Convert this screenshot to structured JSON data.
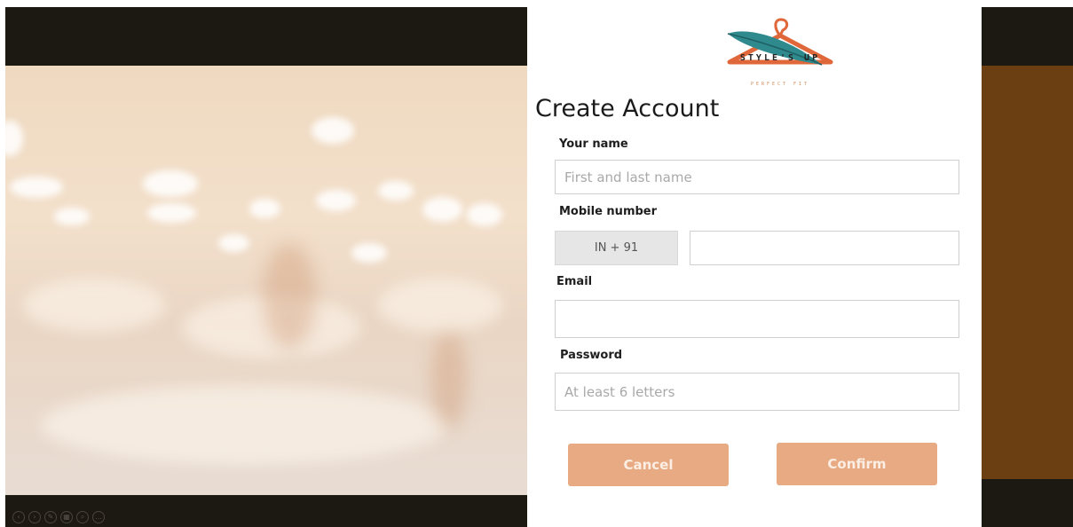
{
  "brand": {
    "name": "STYLE'S UP",
    "tagline": "PERFECT FIT",
    "colors": {
      "teal": "#2f8a8e",
      "orange": "#e0673a",
      "accent": "#e8aa82"
    }
  },
  "form": {
    "title": "Create Account",
    "name": {
      "label": "Your name",
      "placeholder": "First and last name"
    },
    "mobile": {
      "label": "Mobile number",
      "country_code": "IN + 91",
      "value": ""
    },
    "email": {
      "label": "Email",
      "value": ""
    },
    "password": {
      "label": "Password",
      "placeholder": "At least 6 letters"
    },
    "buttons": {
      "cancel": "Cancel",
      "confirm": "Confirm"
    }
  },
  "slideshow_controls": [
    "prev-icon",
    "next-icon",
    "pen-icon",
    "slides-icon",
    "zoom-icon",
    "more-icon"
  ]
}
